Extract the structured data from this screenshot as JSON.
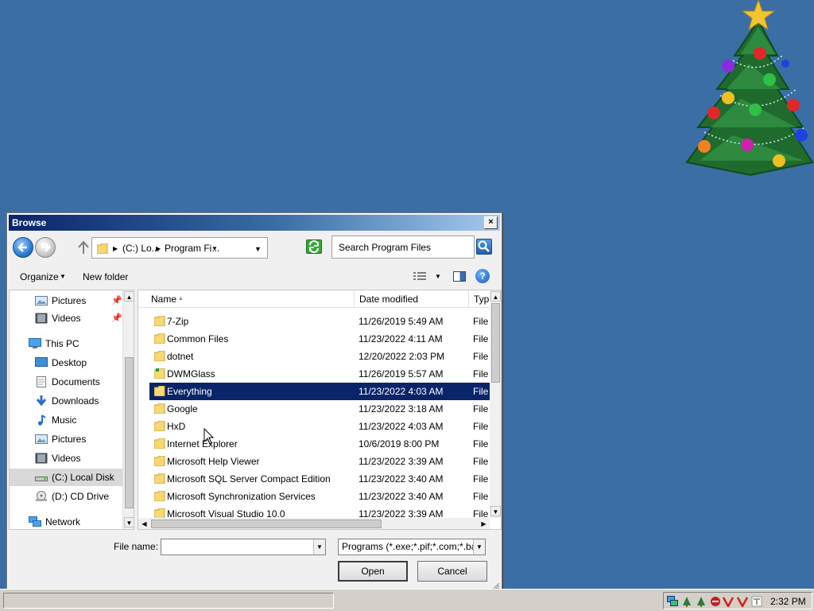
{
  "dialog": {
    "title": "Browse",
    "close_glyph": "×"
  },
  "nav": {
    "breadcrumb_c": "(C:) Lo...",
    "breadcrumb_pf": "Program Fi...",
    "search_placeholder": "Search Program Files"
  },
  "command": {
    "organize": "Organize",
    "new_folder": "New folder",
    "help_glyph": "?"
  },
  "navpane": {
    "items": [
      {
        "label": "Pictures",
        "icon": "pictures-icon",
        "pinned": true
      },
      {
        "label": "Videos",
        "icon": "videos-icon",
        "pinned": true
      },
      {
        "label": "This PC",
        "icon": "computer-icon"
      },
      {
        "label": "Desktop",
        "icon": "desktop-icon"
      },
      {
        "label": "Documents",
        "icon": "documents-icon"
      },
      {
        "label": "Downloads",
        "icon": "downloads-icon"
      },
      {
        "label": "Music",
        "icon": "music-icon"
      },
      {
        "label": "Pictures",
        "icon": "pictures-icon"
      },
      {
        "label": "Videos",
        "icon": "videos-icon"
      },
      {
        "label": "(C:) Local Disk",
        "icon": "drive-icon",
        "selected": true
      },
      {
        "label": "(D:) CD Drive",
        "icon": "cd-drive-icon"
      },
      {
        "label": "Network",
        "icon": "network-icon"
      }
    ]
  },
  "filelist": {
    "columns": {
      "name": "Name",
      "date": "Date modified",
      "type": "Type"
    },
    "rows": [
      {
        "name": "7-Zip",
        "date": "11/26/2019 5:49 AM",
        "type": "File f"
      },
      {
        "name": "Common Files",
        "date": "11/23/2022 4:11 AM",
        "type": "File f"
      },
      {
        "name": "dotnet",
        "date": "12/20/2022 2:03 PM",
        "type": "File f"
      },
      {
        "name": "DWMGlass",
        "date": "11/26/2019 5:57 AM",
        "type": "File f"
      },
      {
        "name": "Everything",
        "date": "11/23/2022 4:03 AM",
        "type": "File f",
        "selected": true
      },
      {
        "name": "Google",
        "date": "11/23/2022 3:18 AM",
        "type": "File f"
      },
      {
        "name": "HxD",
        "date": "11/23/2022 4:03 AM",
        "type": "File f"
      },
      {
        "name": "Internet Explorer",
        "date": "10/6/2019 8:00 PM",
        "type": "File f"
      },
      {
        "name": "Microsoft Help Viewer",
        "date": "11/23/2022 3:39 AM",
        "type": "File f"
      },
      {
        "name": "Microsoft SQL Server Compact Edition",
        "date": "11/23/2022 3:40 AM",
        "type": "File f"
      },
      {
        "name": "Microsoft Synchronization Services",
        "date": "11/23/2022 3:40 AM",
        "type": "File f"
      },
      {
        "name": "Microsoft Visual Studio 10.0",
        "date": "11/23/2022 3:39 AM",
        "type": "File f"
      }
    ]
  },
  "bottom": {
    "file_name_label": "File name:",
    "file_name_value": "",
    "filter_value": "Programs (*.exe;*.pif;*.com;*.ba",
    "open": "Open",
    "cancel": "Cancel"
  },
  "taskbar": {
    "clock": "2:32 PM"
  },
  "colors": {
    "desktop": "#3a6ea5",
    "selection": "#0a246a",
    "folder": "#f8d775"
  }
}
